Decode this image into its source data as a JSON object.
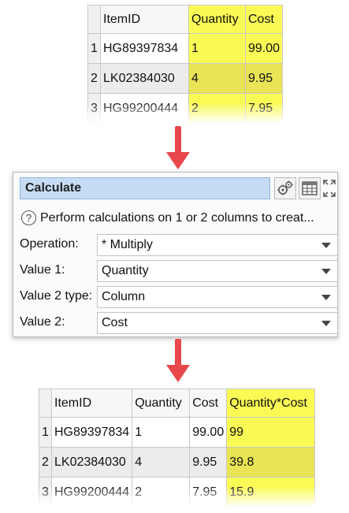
{
  "input_table": {
    "columns": [
      "ItemID",
      "Quantity",
      "Cost"
    ],
    "rows": [
      {
        "num": "1",
        "item_id": "HG89397834",
        "quantity": "1",
        "cost": "99.00"
      },
      {
        "num": "2",
        "item_id": "LK02384030",
        "quantity": "4",
        "cost": "9.95"
      },
      {
        "num": "3",
        "item_id": "HG99200444",
        "quantity": "2",
        "cost": "7.95"
      }
    ]
  },
  "calculate_panel": {
    "title": "Calculate",
    "description": "Perform calculations on 1 or 2 columns to creat...",
    "operation_label": "Operation:",
    "operation_value": "* Multiply",
    "value1_label": "Value 1:",
    "value1_value": "Quantity",
    "value2type_label": "Value 2 type:",
    "value2type_value": "Column",
    "value2_label": "Value 2:",
    "value2_value": "Cost",
    "icons": [
      "gears-icon",
      "table-icon",
      "expand-icon",
      "help-icon",
      "dropdown-caret-icon"
    ]
  },
  "output_table": {
    "columns": [
      "ItemID",
      "Quantity",
      "Cost",
      "Quantity*Cost"
    ],
    "rows": [
      {
        "num": "1",
        "item_id": "HG89397834",
        "quantity": "1",
        "cost": "99.00",
        "product": "99"
      },
      {
        "num": "2",
        "item_id": "LK02384030",
        "quantity": "4",
        "cost": "9.95",
        "product": "39.8"
      },
      {
        "num": "3",
        "item_id": "HG99200444",
        "quantity": "2",
        "cost": "7.95",
        "product": "15.9"
      }
    ]
  },
  "colors": {
    "highlight": "#fafa54",
    "highlight_alt_row": "#e8e456",
    "arrow": "#e8474c",
    "title_bar": "#c6dcf5"
  }
}
